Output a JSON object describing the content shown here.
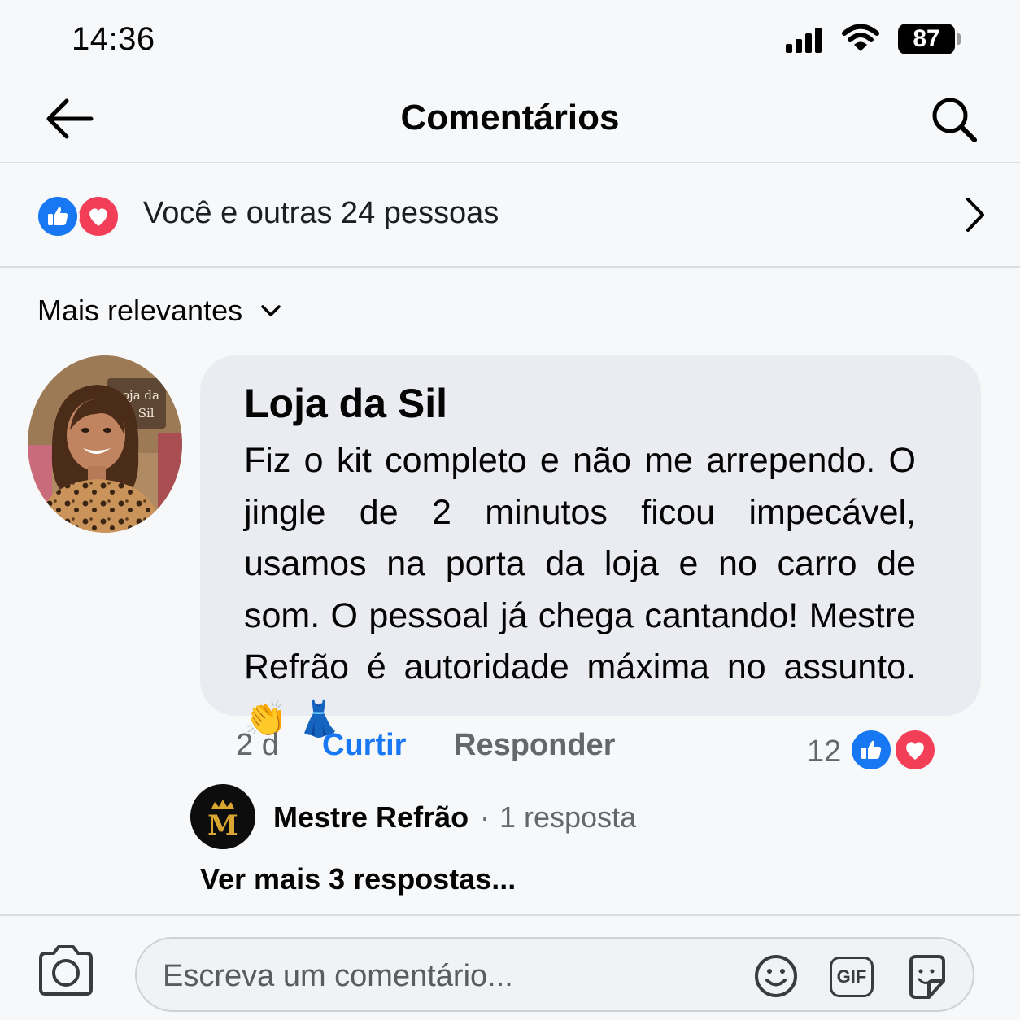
{
  "status_bar": {
    "time": "14:36",
    "battery": "87",
    "icons": [
      "signal-icon",
      "wifi-icon",
      "battery-icon"
    ]
  },
  "header": {
    "title": "Comentários",
    "back_icon": "arrow-left-icon",
    "search_icon": "search-icon"
  },
  "reactions": {
    "summary": "Você e outras 24 pessoas",
    "icons": [
      "like-icon",
      "love-icon"
    ]
  },
  "sort": {
    "label": "Mais relevantes"
  },
  "comment": {
    "author": "Loja da Sil",
    "text": "Fiz o kit completo e não me arrependo. O jingle de 2 minutos ficou impecável, usamos na porta da loja e no carro de som. O pessoal já chega cantando! Mestre Refrão é autoridade máxima no assunto. 👏 👗",
    "avatar_sign": "Loja da\nda Sil",
    "time": "2 d",
    "like_label": "Curtir",
    "reply_label": "Responder",
    "reaction_count": "12"
  },
  "reply": {
    "author": "Mestre Refrão",
    "separator": "·",
    "count_label": "1 resposta",
    "avatar_letter": "M"
  },
  "more_replies": "Ver mais 3 respostas...",
  "composer": {
    "placeholder": "Escreva um comentário...",
    "gif_label": "GIF"
  },
  "colors": {
    "accent_blue": "#1877f2",
    "love_red": "#f33e58",
    "bubble_bg": "#eaecf1",
    "secondary_text": "#65676b"
  }
}
